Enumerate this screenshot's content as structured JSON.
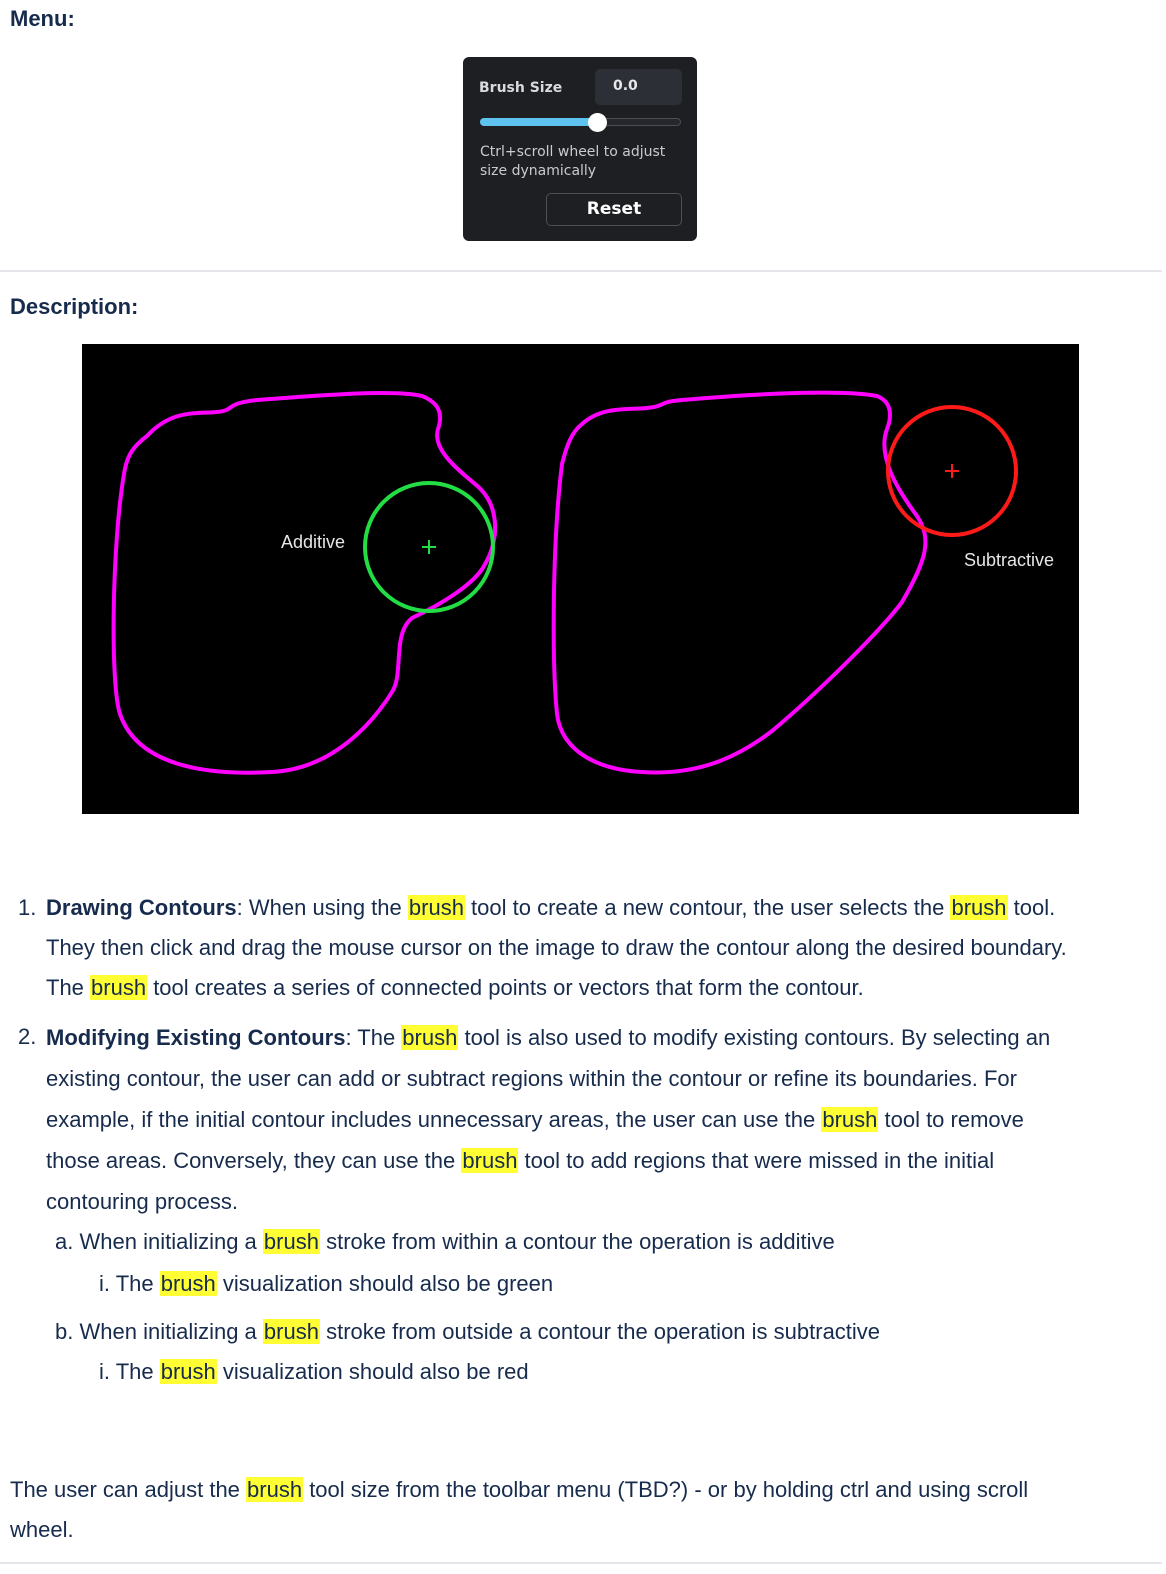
{
  "menu_heading": "Menu:",
  "panel": {
    "label": "Brush Size",
    "value": "0.0",
    "slider_fraction": 0.58,
    "hint": "Ctrl+scroll wheel to adjust size dynamically",
    "reset_label": "Reset"
  },
  "description_heading": "Description:",
  "diagram": {
    "additive_label": "Additive",
    "subtractive_label": "Subtractive",
    "colors": {
      "contour": "#ff00ff",
      "additive": "#22dd44",
      "subtractive": "#ff1a1a",
      "background": "#000000"
    }
  },
  "highlight_word": "brush",
  "list": [
    {
      "marker": "1.",
      "title": "Drawing Contours",
      "parts": [
        ": When using the ",
        "brush",
        " tool to create a new contour, the user selects the ",
        "brush",
        " tool.",
        "They then click and drag the mouse cursor on the image to draw the contour along the desired boundary.",
        "The ",
        "brush",
        " tool creates a series of connected points or vectors that form the contour."
      ]
    },
    {
      "marker": "2.",
      "title": "Modifying Existing Contours",
      "parts": [
        ": The ",
        "brush",
        " tool is also used to modify existing contours. By selecting an",
        "existing contour, the user can add or subtract regions within the contour or refine its boundaries. For",
        "example, if the initial contour includes unnecessary areas, the user can use the ",
        "brush",
        " tool to remove",
        "those areas. Conversely, they can use the ",
        "brush",
        " tool to add regions that were missed in the initial",
        "contouring process."
      ]
    }
  ],
  "sublist": [
    {
      "marker": "a.",
      "parts": [
        "When initializing a ",
        "brush",
        " stroke from within a contour the operation is additive"
      ]
    },
    {
      "marker": "i.",
      "parts": [
        "The ",
        "brush",
        " visualization should also be green"
      ]
    },
    {
      "marker": "b.",
      "parts": [
        "When initializing a ",
        "brush",
        " stroke from outside a contour the operation is subtractive"
      ]
    },
    {
      "marker": "i.",
      "parts": [
        "The ",
        "brush",
        " visualization should also be red"
      ]
    }
  ],
  "footer": {
    "parts": [
      "The user can adjust the ",
      "brush",
      " tool size from the toolbar menu (TBD?) - or by holding ctrl and using scroll",
      "wheel."
    ]
  }
}
